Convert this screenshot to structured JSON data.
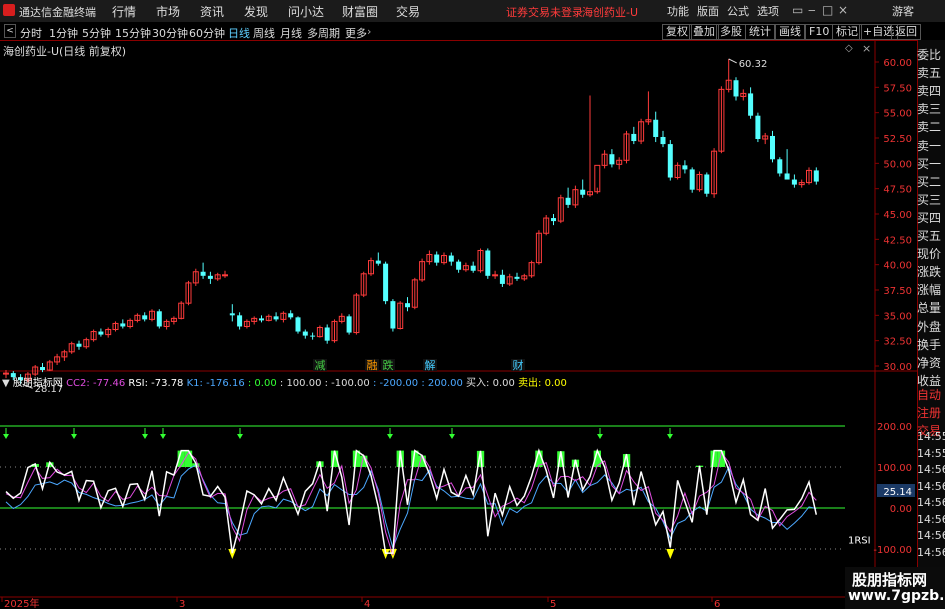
{
  "app": {
    "title": "通达信金融终端",
    "warning": "证券交易未登录",
    "stock_title": "海创药业-U",
    "guest": "游客"
  },
  "menu": [
    "行情",
    "市场",
    "资讯",
    "发现",
    "问小达",
    "财富圈",
    "交易"
  ],
  "right_menu": [
    "功能",
    "版面",
    "公式",
    "选项"
  ],
  "timeframes": [
    "分时",
    "1分钟",
    "5分钟",
    "15分钟",
    "30分钟",
    "60分钟",
    "日线",
    "周线",
    "月线",
    "多周期",
    "更多"
  ],
  "active_timeframe": "日线",
  "toolbar_buttons": [
    "复权",
    "叠加",
    "多股",
    "统计",
    "画线",
    "F10",
    "标记",
    "+自选",
    "返回"
  ],
  "main_chart": {
    "label": "海创药业-U(日线 前复权)",
    "max_label": "60.32",
    "min_label": "28.17",
    "y_ticks": [
      "60.00",
      "57.50",
      "55.00",
      "52.50",
      "50.00",
      "47.50",
      "45.00",
      "42.50",
      "40.00",
      "37.50",
      "35.00",
      "32.50",
      "30.00"
    ],
    "event_markers": [
      {
        "text": "减",
        "color": "#4c4"
      },
      {
        "text": "融",
        "color": "#f90"
      },
      {
        "text": "跌",
        "color": "#4c4"
      },
      {
        "text": "解",
        "color": "#4cf"
      },
      {
        "text": "财",
        "color": "#4cf"
      }
    ]
  },
  "indicator": {
    "name": "股朋指标网",
    "cc2": "CC2: -77.46",
    "rsi": "RSI: -73.78",
    "k1": "K1: -176.16",
    "l0": ": 0.00",
    "l100": ": 100.00",
    "lm100": ": -100.00",
    "lm200": ": -200.00",
    "l200": ": 200.00",
    "buy": "买入: 0.00",
    "sell": "卖出: 0.00",
    "y_ticks": [
      "200.00",
      "100.00",
      "0.00",
      "-100.00"
    ],
    "rsi_tag": "1RSI",
    "colors": {
      "cc2": "#e04ce0",
      "rsi": "#fff",
      "k1": "#4ca8ff",
      "green": "#3f3",
      "yellow": "#ff0"
    }
  },
  "x_axis": [
    "2025年",
    "3",
    "4",
    "5",
    "6"
  ],
  "right_panel": [
    "委比",
    "卖五",
    "卖四",
    "卖三",
    "卖二",
    "卖一",
    "买一",
    "买二",
    "买三",
    "买四",
    "买五",
    "现价",
    "涨跌",
    "涨幅",
    "总量",
    "外盘",
    "换手",
    "净资",
    "收益"
  ],
  "right_panel2": [
    "自动",
    "注册",
    "交易"
  ],
  "time_ticks": [
    "25.14",
    "14:55",
    "14:55",
    "14:56",
    "14:56",
    "14:56",
    "14:56",
    "14:56",
    "14:56"
  ],
  "watermark": {
    "line1": "股朋指标网",
    "line2": "www.7gpzb.com"
  },
  "kline": [
    [
      29.2,
      29.6,
      28.8,
      29.3
    ],
    [
      29.3,
      29.5,
      28.6,
      28.9
    ],
    [
      28.9,
      29.2,
      28.2,
      28.6
    ],
    [
      28.6,
      29.4,
      28.4,
      29.2
    ],
    [
      29.2,
      30.1,
      29.0,
      29.9
    ],
    [
      29.9,
      30.3,
      29.4,
      29.6
    ],
    [
      29.6,
      30.6,
      29.5,
      30.4
    ],
    [
      30.4,
      31.2,
      30.1,
      30.9
    ],
    [
      30.9,
      31.6,
      30.5,
      31.4
    ],
    [
      31.4,
      32.4,
      31.2,
      32.2
    ],
    [
      32.2,
      32.5,
      31.6,
      31.9
    ],
    [
      31.9,
      32.8,
      31.7,
      32.6
    ],
    [
      32.6,
      33.6,
      32.4,
      33.4
    ],
    [
      33.4,
      33.7,
      32.9,
      33.1
    ],
    [
      33.1,
      33.8,
      32.8,
      33.6
    ],
    [
      33.6,
      34.4,
      33.4,
      34.2
    ],
    [
      34.2,
      34.6,
      33.7,
      33.9
    ],
    [
      33.9,
      34.7,
      33.7,
      34.5
    ],
    [
      34.5,
      35.2,
      34.3,
      35.0
    ],
    [
      35.0,
      35.3,
      34.4,
      34.6
    ],
    [
      34.6,
      35.6,
      34.4,
      35.4
    ],
    [
      35.4,
      35.6,
      33.7,
      33.9
    ],
    [
      33.9,
      34.6,
      33.6,
      34.4
    ],
    [
      34.4,
      34.9,
      34.1,
      34.7
    ],
    [
      34.7,
      36.4,
      34.6,
      36.2
    ],
    [
      36.2,
      38.4,
      36.0,
      38.2
    ],
    [
      38.2,
      39.6,
      37.9,
      39.3
    ],
    [
      39.3,
      40.2,
      38.6,
      38.9
    ],
    [
      38.9,
      39.3,
      38.1,
      38.6
    ],
    [
      38.6,
      39.2,
      38.4,
      39.0
    ],
    [
      39.0,
      39.4,
      38.7,
      39.0
    ],
    [
      35.2,
      36.1,
      34.4,
      35.0
    ],
    [
      35.0,
      35.3,
      33.6,
      33.9
    ],
    [
      33.9,
      34.6,
      33.7,
      34.4
    ],
    [
      34.4,
      34.9,
      34.1,
      34.7
    ],
    [
      34.7,
      35.0,
      34.3,
      34.5
    ],
    [
      34.5,
      35.1,
      34.4,
      34.9
    ],
    [
      34.9,
      35.3,
      34.4,
      34.6
    ],
    [
      34.6,
      35.4,
      34.3,
      35.2
    ],
    [
      35.2,
      35.5,
      34.6,
      34.8
    ],
    [
      34.8,
      34.9,
      33.2,
      33.4
    ],
    [
      33.4,
      33.6,
      32.7,
      33.0
    ],
    [
      33.0,
      33.3,
      32.6,
      32.9
    ],
    [
      32.9,
      34.0,
      32.8,
      33.8
    ],
    [
      33.8,
      34.1,
      32.2,
      32.5
    ],
    [
      32.5,
      34.6,
      32.3,
      34.4
    ],
    [
      34.4,
      35.2,
      34.2,
      34.9
    ],
    [
      34.9,
      35.1,
      33.1,
      33.3
    ],
    [
      33.3,
      37.2,
      33.1,
      37.0
    ],
    [
      37.0,
      39.3,
      36.8,
      39.1
    ],
    [
      39.1,
      40.7,
      38.9,
      40.4
    ],
    [
      40.4,
      41.2,
      39.9,
      40.1
    ],
    [
      40.1,
      40.3,
      36.1,
      36.4
    ],
    [
      36.4,
      36.6,
      33.4,
      33.7
    ],
    [
      33.7,
      36.4,
      33.6,
      36.2
    ],
    [
      36.2,
      36.8,
      35.4,
      35.8
    ],
    [
      35.8,
      38.7,
      35.6,
      38.5
    ],
    [
      38.5,
      40.6,
      38.3,
      40.3
    ],
    [
      40.3,
      41.4,
      40.0,
      41.0
    ],
    [
      41.0,
      41.3,
      39.9,
      40.2
    ],
    [
      40.2,
      41.2,
      40.0,
      40.9
    ],
    [
      40.9,
      41.2,
      39.9,
      40.3
    ],
    [
      40.3,
      40.5,
      39.2,
      39.5
    ],
    [
      39.5,
      40.2,
      39.3,
      39.9
    ],
    [
      39.9,
      40.3,
      39.2,
      39.4
    ],
    [
      39.4,
      41.6,
      39.2,
      41.4
    ],
    [
      41.4,
      41.6,
      38.6,
      38.9
    ],
    [
      38.9,
      39.4,
      38.6,
      39.0
    ],
    [
      39.0,
      39.5,
      37.8,
      38.1
    ],
    [
      38.1,
      39.1,
      37.9,
      38.8
    ],
    [
      38.8,
      39.2,
      38.4,
      38.6
    ],
    [
      38.6,
      39.1,
      38.4,
      38.9
    ],
    [
      38.9,
      40.4,
      38.7,
      40.2
    ],
    [
      40.2,
      43.4,
      40.0,
      43.1
    ],
    [
      43.1,
      44.9,
      42.9,
      44.6
    ],
    [
      44.6,
      45.0,
      43.9,
      44.3
    ],
    [
      44.3,
      46.9,
      44.1,
      46.6
    ],
    [
      46.6,
      47.6,
      45.6,
      45.9
    ],
    [
      45.9,
      47.8,
      45.6,
      47.4
    ],
    [
      47.4,
      48.4,
      46.6,
      46.9
    ],
    [
      46.9,
      56.7,
      46.7,
      47.2
    ],
    [
      47.2,
      47.6,
      47.0,
      49.8
    ],
    [
      49.8,
      51.3,
      49.5,
      50.9
    ],
    [
      50.9,
      51.4,
      49.6,
      49.9
    ],
    [
      49.9,
      50.6,
      49.4,
      50.3
    ],
    [
      50.3,
      53.2,
      50.0,
      52.9
    ],
    [
      52.9,
      53.6,
      51.9,
      52.2
    ],
    [
      52.2,
      54.4,
      51.9,
      54.1
    ],
    [
      54.1,
      57.1,
      53.8,
      54.3
    ],
    [
      54.3,
      55.1,
      52.1,
      52.6
    ],
    [
      52.6,
      53.2,
      51.6,
      51.9
    ],
    [
      51.9,
      52.3,
      48.3,
      48.6
    ],
    [
      48.6,
      50.1,
      48.4,
      49.8
    ],
    [
      49.8,
      50.3,
      49.0,
      49.4
    ],
    [
      49.4,
      49.6,
      47.1,
      47.4
    ],
    [
      47.4,
      49.2,
      47.2,
      48.9
    ],
    [
      48.9,
      49.1,
      46.7,
      47.0
    ],
    [
      47.0,
      51.5,
      46.6,
      51.2
    ],
    [
      51.2,
      57.6,
      51.0,
      57.3
    ],
    [
      57.3,
      60.3,
      57.0,
      58.2
    ],
    [
      58.2,
      58.5,
      56.2,
      56.6
    ],
    [
      56.6,
      57.3,
      56.2,
      56.9
    ],
    [
      56.9,
      57.5,
      54.4,
      54.7
    ],
    [
      54.7,
      55.0,
      52.1,
      52.4
    ],
    [
      52.4,
      53.0,
      51.9,
      52.7
    ],
    [
      52.7,
      53.2,
      50.1,
      50.4
    ],
    [
      50.4,
      50.6,
      48.7,
      49.0
    ],
    [
      49.0,
      51.4,
      48.8,
      48.4
    ],
    [
      48.4,
      48.9,
      47.6,
      47.9
    ],
    [
      47.9,
      48.4,
      47.6,
      48.1
    ],
    [
      48.1,
      49.6,
      47.9,
      49.3
    ],
    [
      49.3,
      49.6,
      47.9,
      48.2
    ]
  ]
}
